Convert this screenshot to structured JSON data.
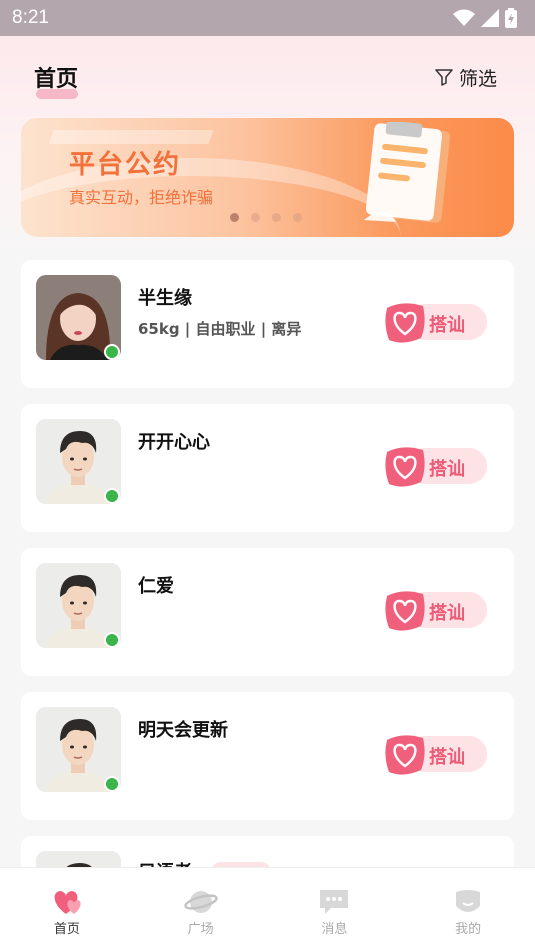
{
  "status_bar": {
    "time": "8:21"
  },
  "header": {
    "title": "首页",
    "filter_label": "筛选"
  },
  "banner": {
    "title": "平台公约",
    "subtitle": "真实互动，拒绝诈骗",
    "dot_count": 4,
    "active_dot": 0
  },
  "chat_label": "搭讪",
  "users": [
    {
      "name": "半生缘",
      "info": "65kg | 自由职业 | 离异",
      "online": true,
      "avatar": "photo-woman"
    },
    {
      "name": "开开心心",
      "info": "",
      "online": true,
      "avatar": "illustrated-man"
    },
    {
      "name": "仁爱",
      "info": "",
      "online": true,
      "avatar": "illustrated-man"
    },
    {
      "name": "明天会更新",
      "info": "",
      "online": true,
      "avatar": "illustrated-man"
    }
  ],
  "partial_user": {
    "name": "只语者",
    "avatar": "illustrated-man"
  },
  "tabbar": {
    "items": [
      {
        "label": "首页",
        "icon": "home-heart-icon",
        "active": true
      },
      {
        "label": "广场",
        "icon": "planet-icon",
        "active": false
      },
      {
        "label": "消息",
        "icon": "message-icon",
        "active": false
      },
      {
        "label": "我的",
        "icon": "profile-icon",
        "active": false
      }
    ]
  },
  "colors": {
    "accent": "#ee5b76",
    "banner_orange": "#f2713a",
    "online": "#39b54a"
  }
}
